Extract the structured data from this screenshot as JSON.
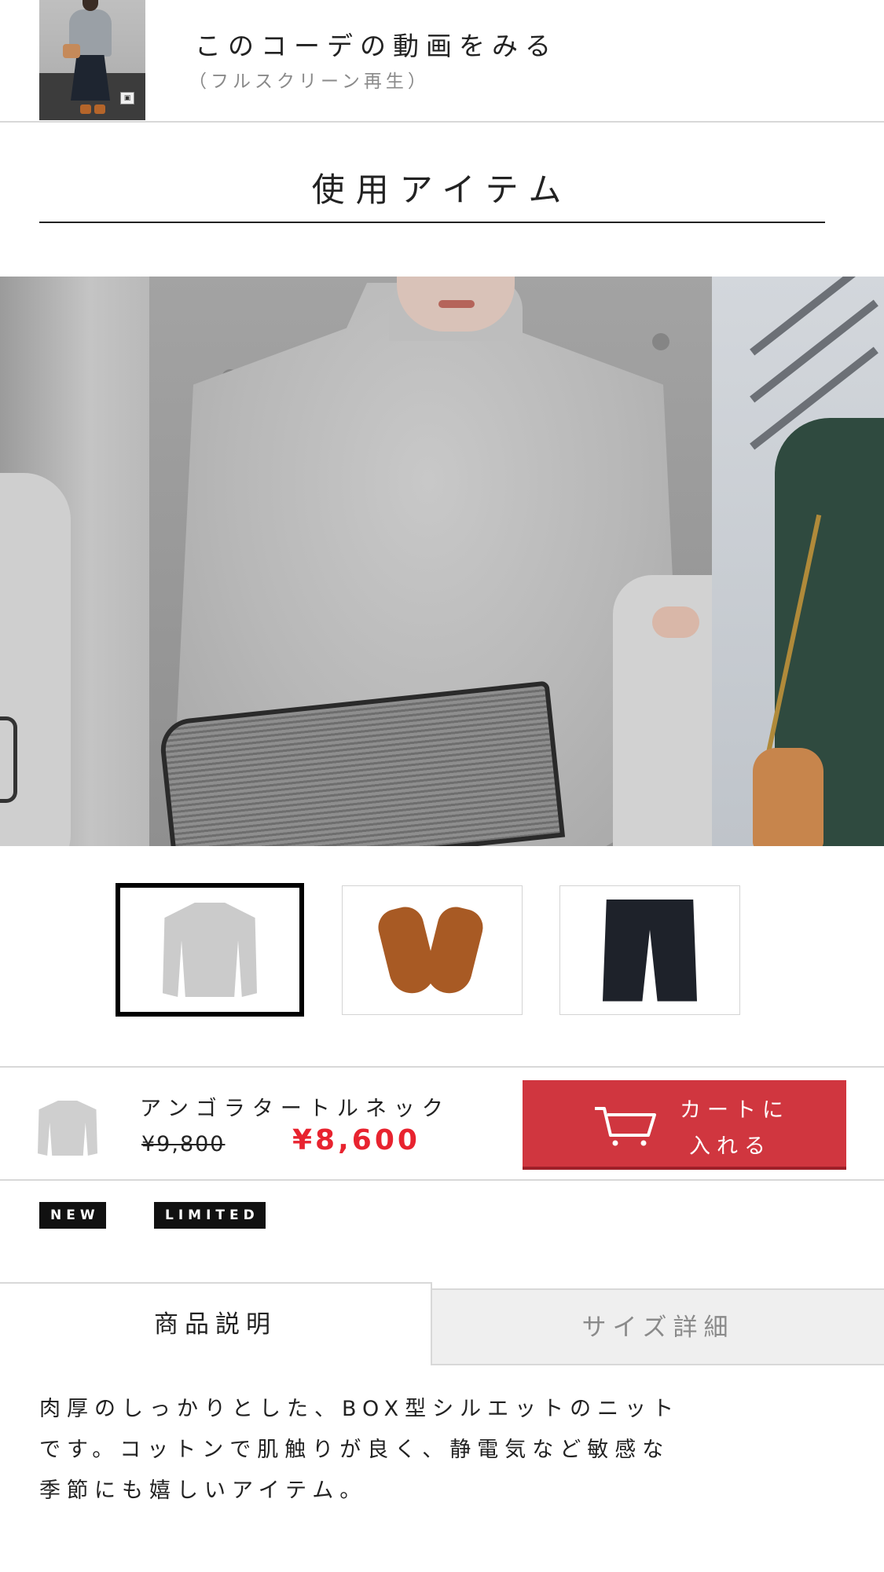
{
  "video": {
    "title": "このコーデの動画をみる",
    "subtitle": "（フルスクリーン再生）"
  },
  "section": {
    "title": "使用アイテム"
  },
  "carousel": {
    "slides": [
      "outfit-photo-prev",
      "outfit-photo-current",
      "outfit-photo-next"
    ],
    "thumbnails": [
      {
        "name": "knit-sweater",
        "selected": true
      },
      {
        "name": "leather-loafers",
        "selected": false
      },
      {
        "name": "black-shorts",
        "selected": false
      }
    ]
  },
  "item": {
    "name": "アンゴラタートルネック",
    "old_price": "¥9,800",
    "price": "¥8,600",
    "cart_line1": "カートに",
    "cart_line2": "入れる",
    "cart_icon": "cart-icon",
    "price_color": "#e8232f",
    "button_color": "#d0363f"
  },
  "badges": {
    "new": "NEW",
    "limited": "LIMITED"
  },
  "tabs": {
    "description": "商品説明",
    "size": "サイズ詳細",
    "active": "description"
  },
  "description": {
    "line1": "肉厚のしっかりとした、BOX型シルエットのニット",
    "line2": "です。コットンで肌触りが良く、静電気など敏感な",
    "line3": "季節にも嬉しいアイテム。"
  }
}
